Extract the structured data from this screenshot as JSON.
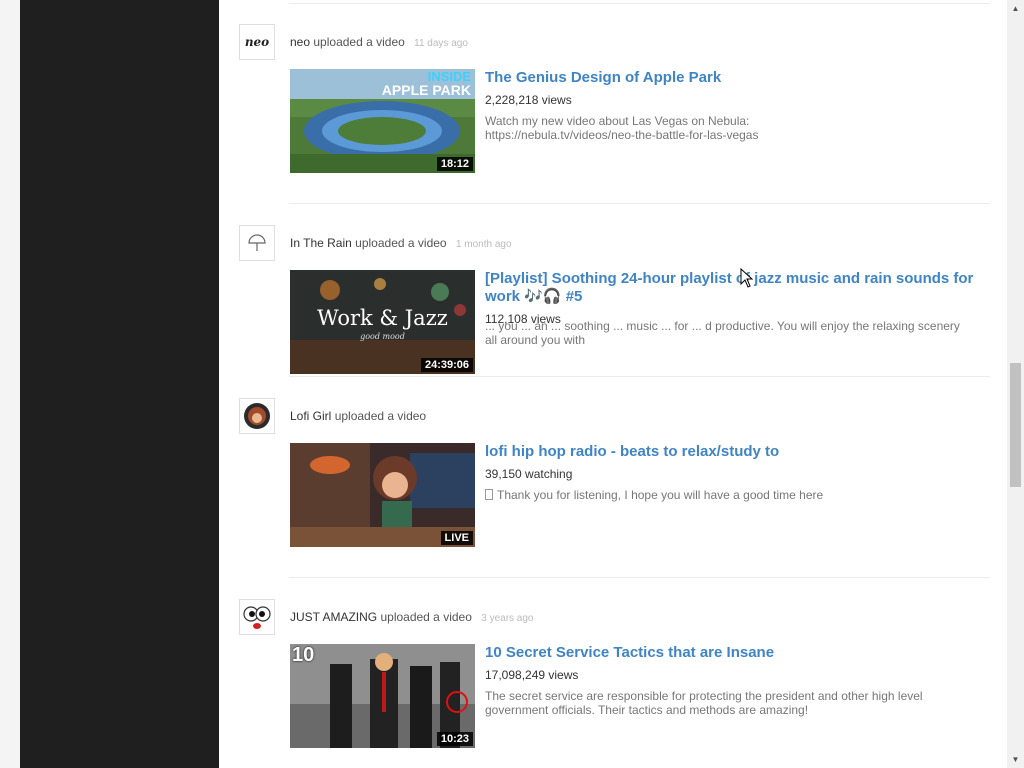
{
  "feed": {
    "entries": [
      {
        "user": "neo",
        "action": "uploaded a video",
        "ago": "11 days ago",
        "avatar_text": "neo",
        "title": "The Genius Design of Apple Park",
        "views": "2,228,218 views",
        "description": "Watch my new video about Las Vegas on Nebula: https://nebula.tv/videos/neo-the-battle-for-las-vegas",
        "duration": "18:12",
        "thumb_line1": "INSIDE",
        "thumb_line2": "APPLE PARK"
      },
      {
        "user": "In The Rain",
        "action": "uploaded a video",
        "ago": "1 month ago",
        "title": "[Playlist] Soothing 24-hour playlist of jazz music and rain sounds for work 🎶🎧 #5",
        "views": "112,108 views",
        "description": "... you ... an ... soothing ... music ... for ... d productive. You will enjoy the relaxing scenery all around you with",
        "duration": "24:39:06",
        "thumb_text": "Work & Jazz",
        "thumb_sub": "good mood"
      },
      {
        "user": "Lofi Girl",
        "action": "uploaded a video",
        "title": "lofi hip hop radio - beats to relax/study to",
        "views": "39,150 watching",
        "description": "Thank you for listening, I hope you will have a good time here",
        "duration": "LIVE"
      },
      {
        "user": "JUST AMAZING",
        "action": "uploaded a video",
        "ago": "3 years ago",
        "title": "10 Secret Service Tactics that are Insane",
        "views": "17,098,249 views",
        "description": "The secret service are responsible for protecting the president and other high level government officials. Their tactics and methods are amazing!",
        "duration": "10:23",
        "thumb_number": "10"
      }
    ]
  },
  "colors": {
    "link": "#3f84c5",
    "dark_panel": "#1f1f1f"
  }
}
